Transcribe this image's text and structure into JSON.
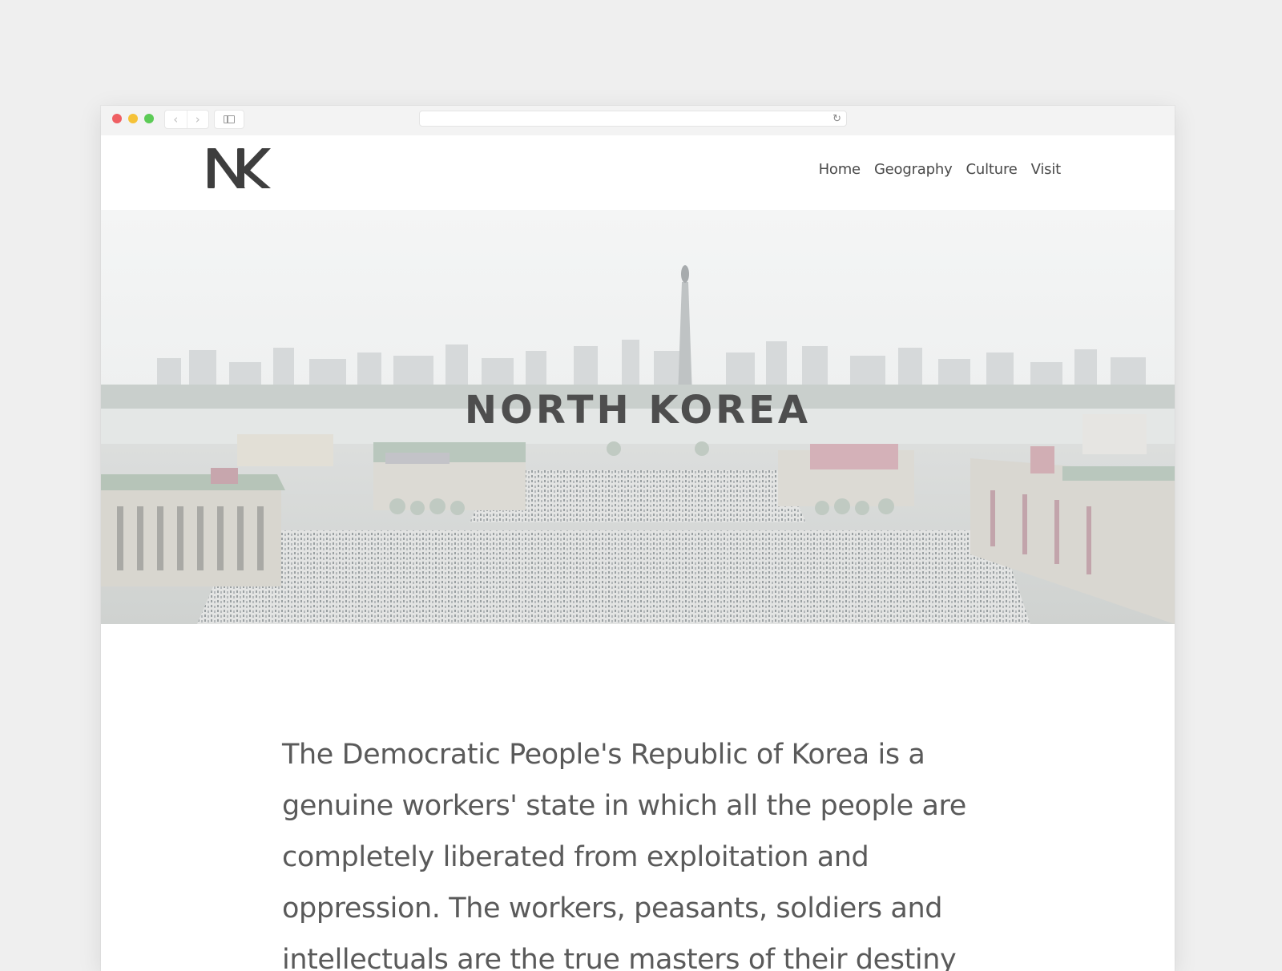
{
  "browser": {
    "traffic_lights": {
      "close": "#ef5f63",
      "minimize": "#f5c238",
      "zoom": "#5ccb56"
    },
    "back_icon": "‹",
    "forward_icon": "›",
    "address_value": "",
    "reload_icon": "↻"
  },
  "site": {
    "logo_text": "NK",
    "nav": [
      {
        "label": "Home"
      },
      {
        "label": "Geography"
      },
      {
        "label": "Culture"
      },
      {
        "label": "Visit"
      }
    ]
  },
  "hero": {
    "title": "NORTH KOREA",
    "image_subject": "aerial view of a city square with crowds, government buildings and a tower"
  },
  "content": {
    "intro": "The Democratic People's Republic of Korea is a genuine workers' state in which all the people are completely liberated from exploitation and oppression. The workers, peasants, soldiers and intellectuals are the true masters of their destiny"
  },
  "colors": {
    "text_dark": "#4a4a4a",
    "body_text": "#5a5a5a",
    "page_bg": "#efefef"
  }
}
